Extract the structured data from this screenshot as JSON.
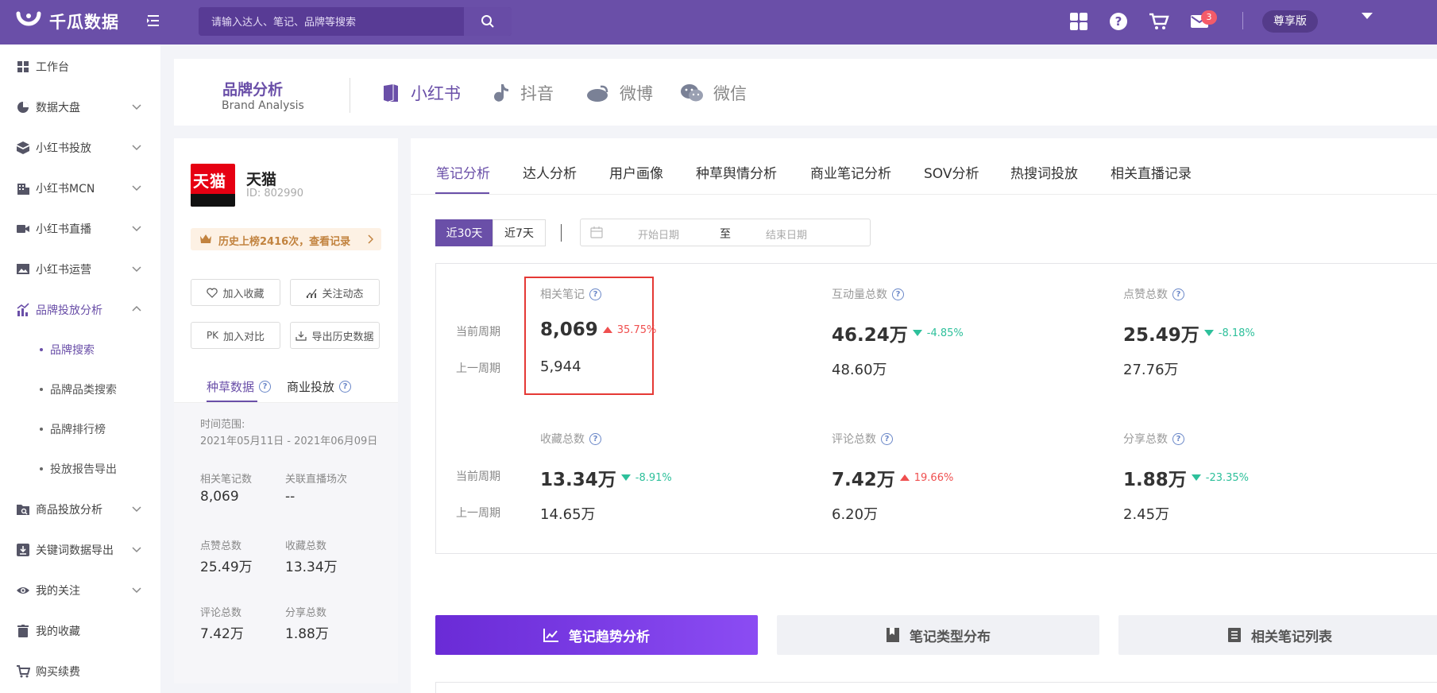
{
  "topbar": {
    "logo_text": "千瓜数据",
    "search_placeholder": "请输入达人、笔记、品牌等搜索",
    "badge_count": "3",
    "plan_label": "尊享版",
    "icons": [
      "apps-icon",
      "help-icon",
      "cart-icon",
      "mail-icon",
      "chevron-down-icon"
    ]
  },
  "sidebar": {
    "items": [
      {
        "label": "工作台",
        "icon": "dashboard-icon"
      },
      {
        "label": "数据大盘",
        "icon": "pie-chart-icon"
      },
      {
        "label": "小红书投放",
        "icon": "box-icon"
      },
      {
        "label": "小红书MCN",
        "icon": "building-icon"
      },
      {
        "label": "小红书直播",
        "icon": "video-icon"
      },
      {
        "label": "小红书运营",
        "icon": "image-icon"
      },
      {
        "label": "品牌投放分析",
        "icon": "bar-chart-icon"
      },
      {
        "label": "商品投放分析",
        "icon": "folder-search-icon"
      },
      {
        "label": "关键词数据导出",
        "icon": "download-icon"
      },
      {
        "label": "我的关注",
        "icon": "eye-icon"
      },
      {
        "label": "我的收藏",
        "icon": "trash-icon"
      },
      {
        "label": "购买续费",
        "icon": "cart-icon"
      }
    ],
    "subitems": [
      "品牌搜索",
      "品牌品类搜索",
      "品牌排行榜",
      "投放报告导出"
    ]
  },
  "brand_header": {
    "title": "品牌分析",
    "subtitle": "Brand Analysis",
    "platforms": [
      "小红书",
      "抖音",
      "微博",
      "微信"
    ]
  },
  "brand_info": {
    "logo_text": "天猫",
    "name": "天猫",
    "id": "ID:  802990",
    "history": "历史上榜2416次，查看记录",
    "buttons": [
      "加入收藏",
      "关注动态",
      "加入对比",
      "导出历史数据"
    ],
    "tabs": [
      "种草数据",
      "商业投放"
    ],
    "time_label": "时间范围:",
    "time_range": "2021年05月11日 - 2021年06月09日",
    "stats": [
      {
        "label": "相关笔记数",
        "value": "8,069"
      },
      {
        "label": "关联直播场次",
        "value": "--"
      },
      {
        "label": "点赞总数",
        "value": "25.49万"
      },
      {
        "label": "收藏总数",
        "value": "13.34万"
      },
      {
        "label": "评论总数",
        "value": "7.42万"
      },
      {
        "label": "分享总数",
        "value": "1.88万"
      }
    ]
  },
  "main": {
    "tabs": [
      "笔记分析",
      "达人分析",
      "用户画像",
      "种草舆情分析",
      "商业笔记分析",
      "SOV分析",
      "热搜词投放",
      "相关直播记录"
    ],
    "periods": [
      "近30天",
      "近7天"
    ],
    "date_start_placeholder": "开始日期",
    "date_to": "至",
    "date_end_placeholder": "结束日期",
    "row_current": "当前周期",
    "row_previous": "上一周期",
    "metrics": [
      {
        "title": "相关笔记",
        "current": "8,069",
        "change": "35.75%",
        "direction": "up",
        "previous": "5,944"
      },
      {
        "title": "互动量总数",
        "current": "46.24万",
        "change": "-4.85%",
        "direction": "down",
        "previous": "48.60万"
      },
      {
        "title": "点赞总数",
        "current": "25.49万",
        "change": "-8.18%",
        "direction": "down",
        "previous": "27.76万"
      },
      {
        "title": "收藏总数",
        "current": "13.34万",
        "change": "-8.91%",
        "direction": "down",
        "previous": "14.65万"
      },
      {
        "title": "评论总数",
        "current": "7.42万",
        "change": "19.66%",
        "direction": "up",
        "previous": "6.20万"
      },
      {
        "title": "分享总数",
        "current": "1.88万",
        "change": "-23.35%",
        "direction": "down",
        "previous": "2.45万"
      }
    ],
    "actions": [
      "笔记趋势分析",
      "笔记类型分布",
      "相关笔记列表"
    ]
  },
  "colors": {
    "brand": "#6a4fa8",
    "up": "#ef4f4f",
    "down": "#2ec09b",
    "highlight": "#e53935"
  }
}
